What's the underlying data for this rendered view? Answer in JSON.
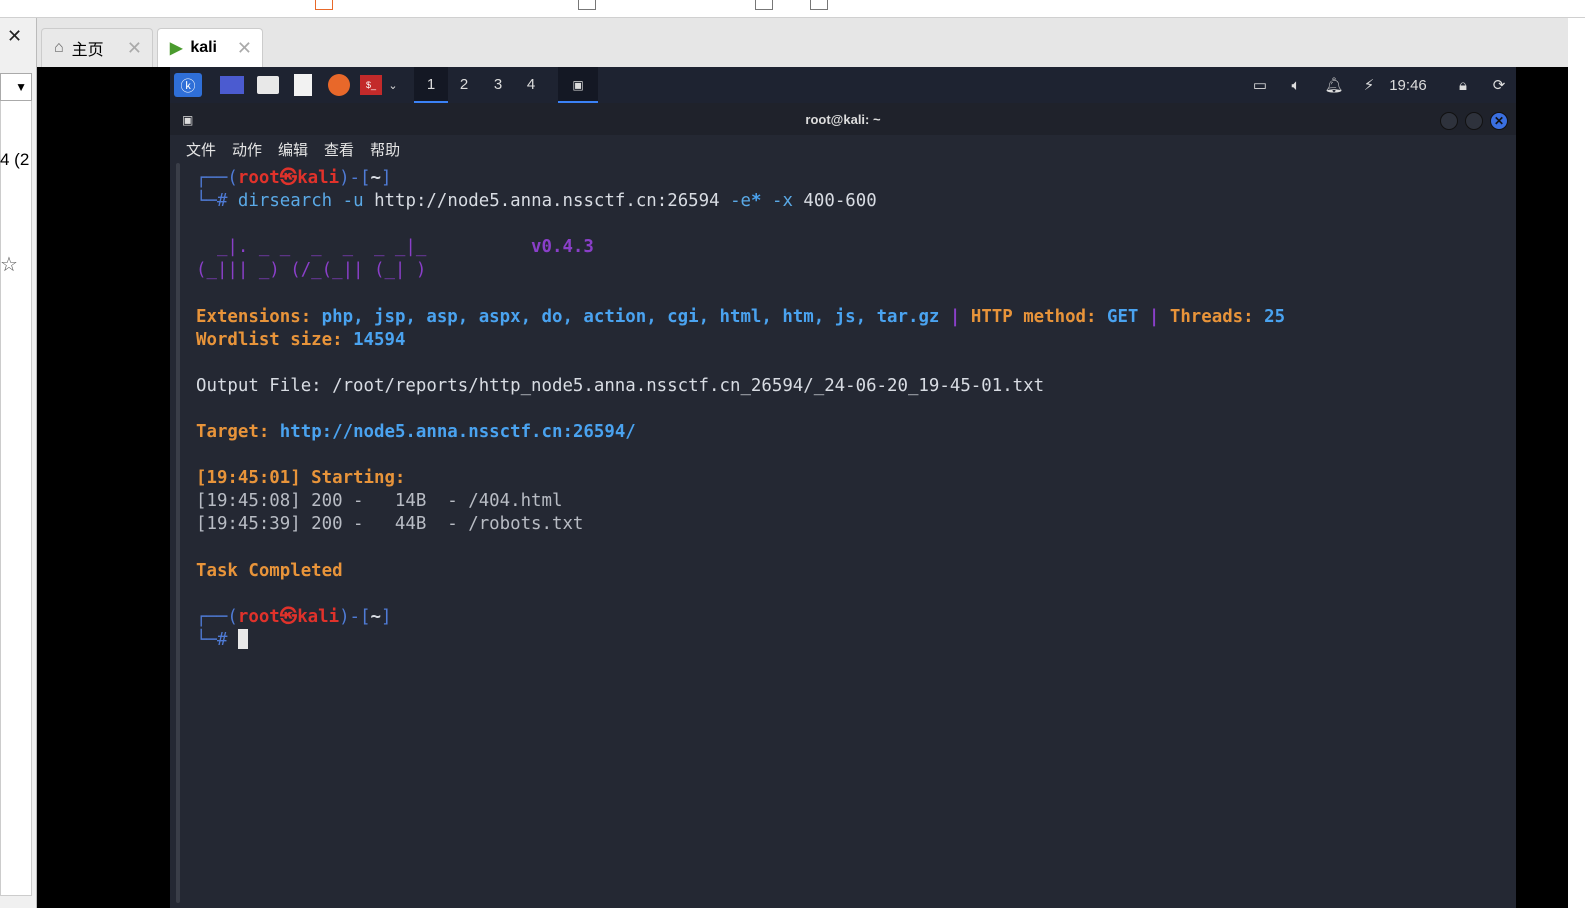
{
  "browser": {
    "tabs": [
      {
        "label": "主页",
        "icon": "home-icon"
      },
      {
        "label": "kali",
        "icon": "vm-icon"
      }
    ],
    "left_text": "4 (2"
  },
  "panel": {
    "workspaces": [
      "1",
      "2",
      "3",
      "4"
    ],
    "clock": "19:46"
  },
  "terminal": {
    "title": "root@kali: ~",
    "menu": [
      "文件",
      "动作",
      "编辑",
      "查看",
      "帮助"
    ],
    "prompt": {
      "user": "root",
      "host": "kali",
      "dir": "~",
      "open": "┌──(",
      "sep": "㉿",
      "mid": ")-[",
      "close": "]",
      "hash": "└─#"
    },
    "command": {
      "cmd": "dirsearch",
      "u": "-u",
      "url": "http://node5.anna.nssctf.cn:26594",
      "e": "-e",
      "star": "*",
      "x": "-x",
      "range": "400-600"
    },
    "banner": {
      "art1": "  _|. _ _  _  _  _ _|_",
      "art2": "(_||| _) (/_(_|| (_| )",
      "version": "v0.4.3"
    },
    "ext_label": "Extensions:",
    "ext_value": "php, jsp, asp, aspx, do, action, cgi, html, htm, js, tar.gz",
    "pipe": "|",
    "method_label": "HTTP method:",
    "method_value": "GET",
    "threads_label": "Threads:",
    "threads_value": "25",
    "wordlist_label": "Wordlist size:",
    "wordlist_value": "14594",
    "output_file": "Output File: /root/reports/http_node5.anna.nssctf.cn_26594/_24-06-20_19-45-01.txt",
    "target_label": "Target:",
    "target_value": "http://node5.anna.nssctf.cn:26594/",
    "starting": "[19:45:01] Starting:",
    "results": [
      "[19:45:08] 200 -   14B  - /404.html",
      "[19:45:39] 200 -   44B  - /robots.txt"
    ],
    "completed": "Task Completed"
  }
}
